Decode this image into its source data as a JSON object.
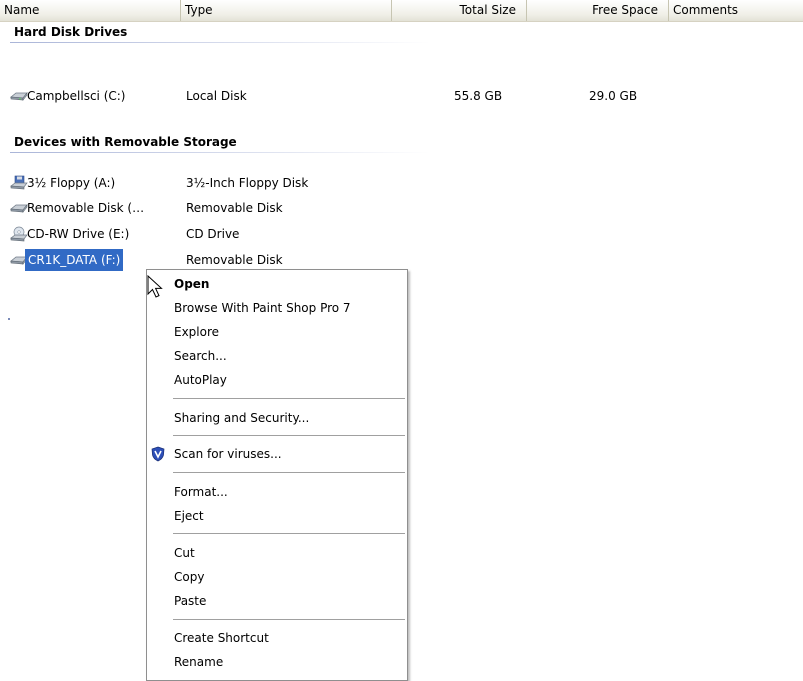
{
  "columns": {
    "name": "Name",
    "type": "Type",
    "total_size": "Total Size",
    "free_space": "Free Space",
    "comments": "Comments"
  },
  "groups": {
    "hard_disk": "Hard Disk Drives",
    "removable": "Devices with Removable Storage"
  },
  "drives": [
    {
      "name": "Campbellsci (C:)",
      "type": "Local Disk",
      "total": "55.8 GB",
      "free": "29.0 GB",
      "icon": "hard-disk-icon"
    },
    {
      "name": "3½ Floppy (A:)",
      "type": "3½-Inch Floppy Disk",
      "total": "",
      "free": "",
      "icon": "floppy-drive-icon"
    },
    {
      "name": "Removable Disk (…",
      "type": "Removable Disk",
      "total": "",
      "free": "",
      "icon": "removable-disk-icon"
    },
    {
      "name": "CD-RW Drive (E:)",
      "type": "CD Drive",
      "total": "",
      "free": "",
      "icon": "cd-drive-icon"
    },
    {
      "name": "CR1K_DATA (F:)",
      "type": "Removable Disk",
      "total": "",
      "free": "",
      "icon": "removable-disk-icon",
      "selected": true
    }
  ],
  "context_menu": {
    "open": "Open",
    "browse": "Browse With Paint Shop Pro 7",
    "explore": "Explore",
    "search": "Search...",
    "autoplay": "AutoPlay",
    "sharing": "Sharing and Security...",
    "scan": "Scan for viruses...",
    "format": "Format...",
    "eject": "Eject",
    "cut": "Cut",
    "copy": "Copy",
    "paste": "Paste",
    "create_shortcut": "Create Shortcut",
    "rename": "Rename"
  },
  "colors": {
    "selection": "#316ac5",
    "header_bg": "#ebeadb",
    "group_line": "#aab5d8"
  }
}
